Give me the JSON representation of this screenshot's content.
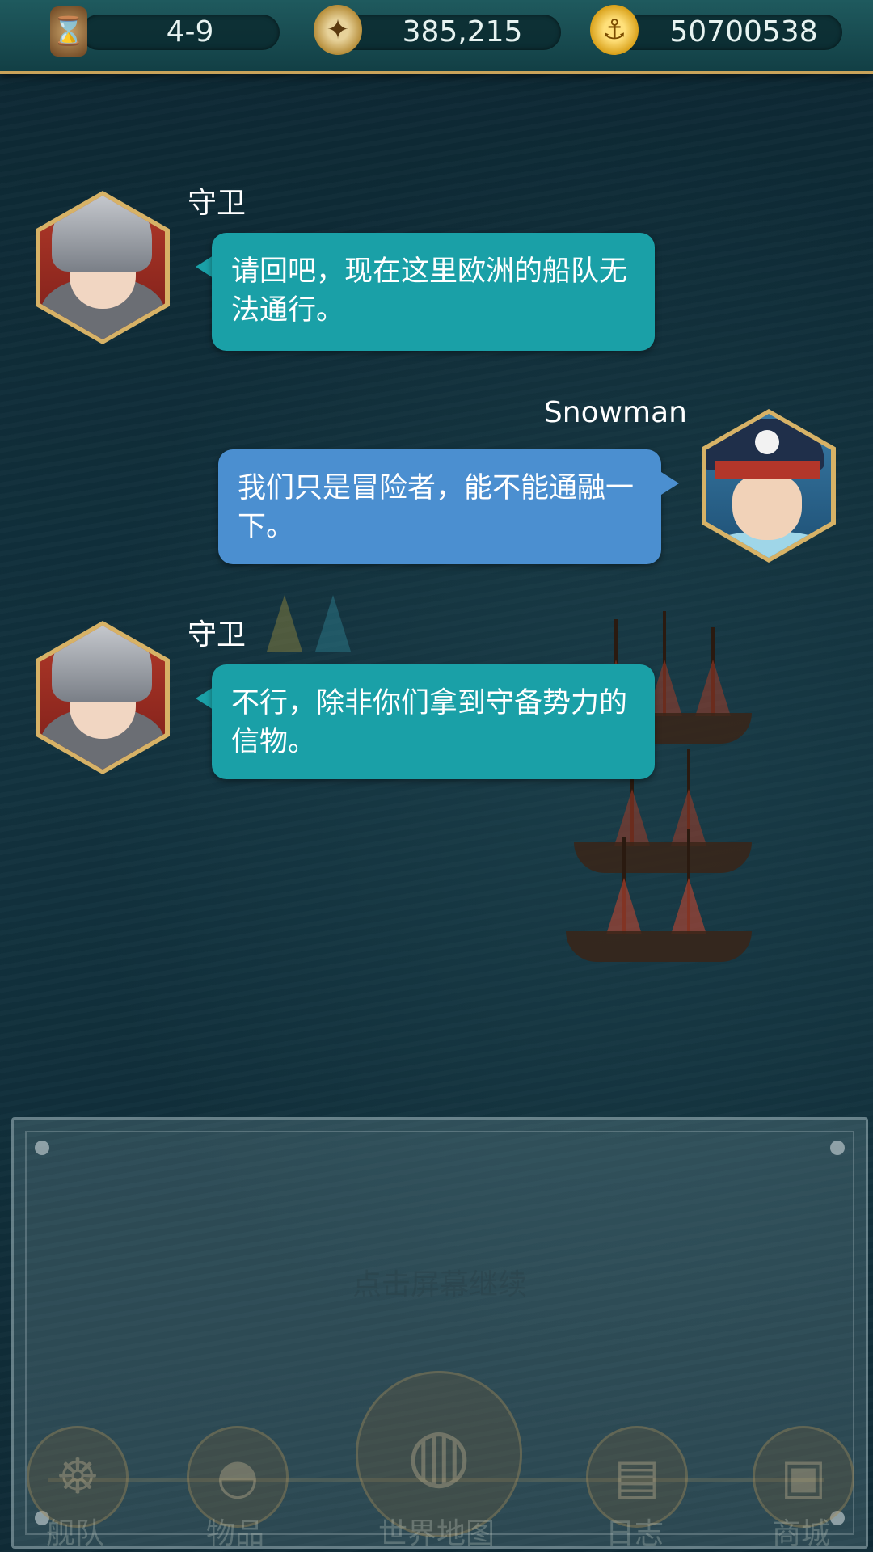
{
  "topbar": {
    "stage": "4-9",
    "compass_value": "385,215",
    "gold": "50700538",
    "icons": [
      "hourglass-icon",
      "compass-icon",
      "anchor-coin-icon"
    ]
  },
  "dialogue": [
    {
      "speaker": "守卫",
      "text": "请回吧，现在这里欧洲的船队无法通行。",
      "side": "left",
      "color": "#1aa0a7"
    },
    {
      "speaker": "Snowman",
      "text": "我们只是冒险者，能不能通融一下。",
      "side": "right",
      "color": "#4b8fd0"
    },
    {
      "speaker": "守卫",
      "text": "不行，除非你们拿到守备势力的信物。",
      "side": "left",
      "color": "#1aa0a7"
    }
  ],
  "panel": {
    "hint": "点击屏幕继续"
  },
  "nav": {
    "items": [
      {
        "label": "舰队",
        "icon": "ship-wheel-icon"
      },
      {
        "label": "物品",
        "icon": "bag-icon"
      },
      {
        "label": "世界地图",
        "icon": "globe-icon"
      },
      {
        "label": "日志",
        "icon": "scroll-icon"
      },
      {
        "label": "商城",
        "icon": "chest-icon"
      }
    ]
  }
}
